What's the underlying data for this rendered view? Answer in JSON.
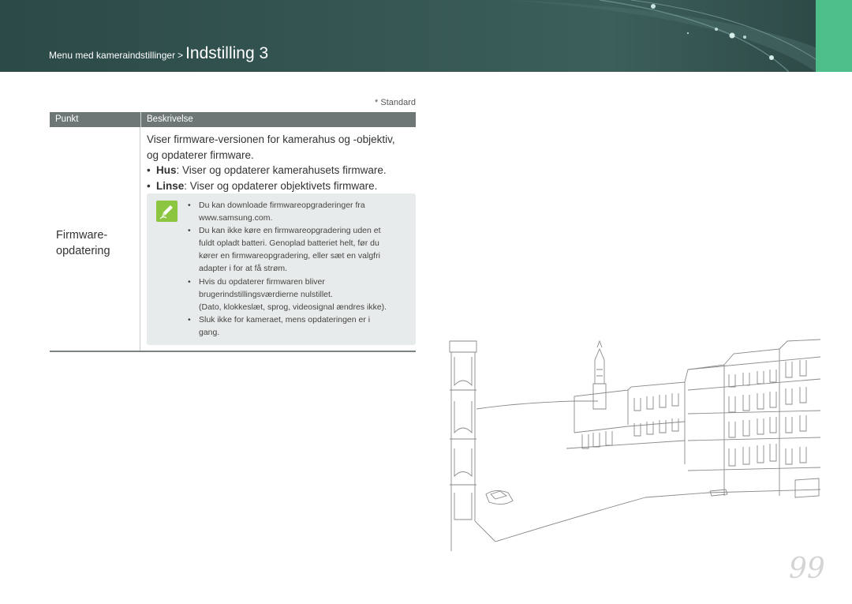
{
  "header": {
    "breadcrumb_parent": "Menu med kameraindstillinger",
    "breadcrumb_separator": ">",
    "breadcrumb_current": "Indstilling 3",
    "accent_color": "#4dbd8a",
    "bar_color": "#2f4c49"
  },
  "legend": {
    "standard": "* Standard"
  },
  "table": {
    "headers": [
      "Punkt",
      "Beskrivelse"
    ],
    "row": {
      "item_line1": "Firmware-",
      "item_line2": "opdatering",
      "desc_line1": "Viser firmware-versionen for kamerahus og -objektiv,",
      "desc_line2": "og opdaterer firmware.",
      "bullets": [
        {
          "term": "Hus",
          "text": ": Viser og opdaterer kamerahusets firmware."
        },
        {
          "term": "Linse",
          "text": ": Viser og opdaterer objektivets firmware."
        }
      ]
    }
  },
  "note": {
    "icon": "pencil-note-icon",
    "items": [
      [
        "Du kan downloade firmwareopgraderinger fra",
        "www.samsung.com."
      ],
      [
        "Du kan ikke køre en firmwareopgradering uden et",
        "fuldt opladt batteri. Genoplad batteriet helt, før du",
        "kører en firmwareopgradering, eller sæt en valgfri",
        "adapter i for at få strøm."
      ],
      [
        "Hvis du opdaterer firmwaren bliver",
        "brugerindstillingsværdierne nulstillet.",
        "(Dato, klokkeslæt, sprog, videosignal ændres ikke)."
      ],
      [
        "Sluk ikke for kameraet, mens opdateringen er i",
        "gang."
      ]
    ]
  },
  "page_number": "99"
}
